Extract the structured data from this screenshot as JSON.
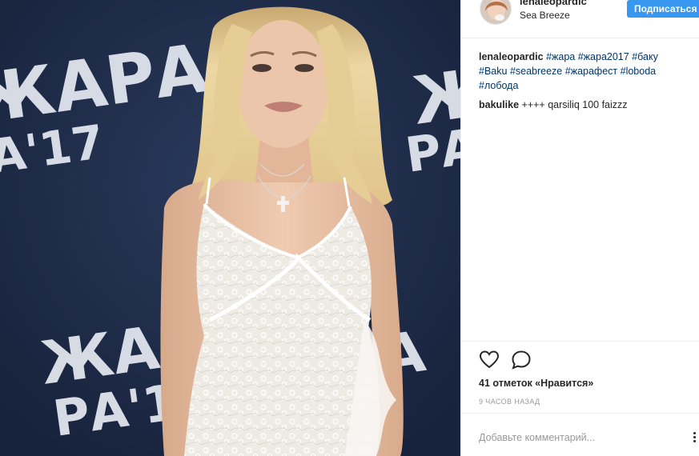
{
  "header": {
    "username": "lenaleopardic",
    "location": "Sea Breeze",
    "follow_label": "Подписаться"
  },
  "photo": {
    "backdrop_text_top": "ЖАРА",
    "backdrop_text_mid": "А'17",
    "backdrop_text_bottom_left_1": "ЖА",
    "backdrop_text_bottom_left_2": "РА'17",
    "backdrop_text_right_1": "Ж",
    "backdrop_text_right_2": "РА",
    "colors": {
      "backdrop": "#1f2d4b",
      "lettering": "#e8ecf3",
      "hair": "#e3c98f",
      "skin": "#e7c0a4",
      "dress": "#f3f1ee"
    }
  },
  "caption": {
    "username": "lenaleopardic",
    "hashtags": [
      "#жара",
      "#жара2017",
      "#баку",
      "#Baku",
      "#seabreeze",
      "#жарафест",
      "#loboda",
      "#лобода"
    ]
  },
  "comments": [
    {
      "username": "bakulike",
      "text": "++++ qarsiliq 100 faizzz"
    }
  ],
  "actions": {
    "like_icon": "heart-icon",
    "comment_icon": "comment-icon"
  },
  "likes_text": "41 отметок «Нравится»",
  "timestamp": "9 часов назад",
  "add_comment_placeholder": "Добавьте комментарий...",
  "colors": {
    "accent": "#3897f0",
    "hashtag": "#003569",
    "muted": "#999999",
    "text": "#262626",
    "divider": "#efefef"
  }
}
